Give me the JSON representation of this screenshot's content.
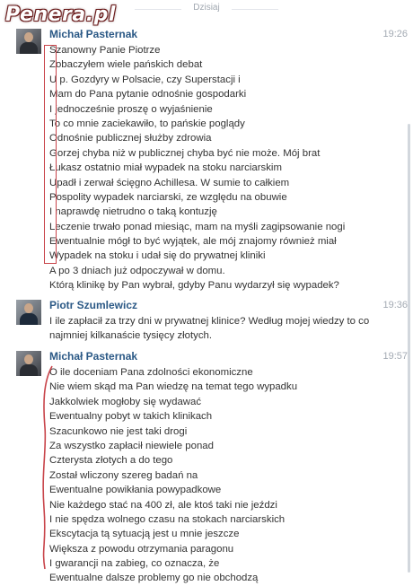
{
  "watermark": "Penera.pl",
  "date_separator": "Dzisiaj",
  "messages": [
    {
      "sender": "Michał Pasternak",
      "time": "19:26",
      "lines": [
        "Szanowny Panie Piotrze",
        "Zobaczyłem wiele pańskich debat",
        "U p. Gozdyry w Polsacie, czy Superstacji i",
        "Mam do Pana pytanie odnośnie gospodarki",
        "I jednocześnie proszę o wyjaśnienie",
        "To co mnie zaciekawiło, to pańskie poglądy",
        "Odnośnie publicznej służby zdrowia",
        "Gorzej chyba niż w publicznej chyba być nie może. Mój brat",
        "Łukasz ostatnio miał wypadek na stoku narciarskim",
        "Upadł i zerwał ścięgno Achillesa. W sumie to całkiem",
        "Pospolity wypadek narciarski, ze względu na obuwie",
        "I naprawdę nietrudno o taką kontuzję",
        "Leczenie trwało ponad miesiąc, mam na myśli zagipsowanie nogi",
        "Ewentualnie mógł to być wyjątek, ale mój znajomy również miał",
        "Wypadek na stoku i udał się do prywatnej kliniki",
        "A po 3 dniach już odpoczywał w domu.",
        "Którą klinikę by Pan wybrał, gdyby Panu wydarzył się wypadek?"
      ]
    },
    {
      "sender": "Piotr Szumlewicz",
      "time": "19:36",
      "text": "I ile zapłacił za trzy dni w prywatnej klinice? Według mojej wiedzy to co najmniej kilkanaście tysięcy złotych."
    },
    {
      "sender": "Michał Pasternak",
      "time": "19:57",
      "lines": [
        "O ile doceniam Pana zdolności ekonomiczne",
        "Nie wiem skąd ma Pan wiedzę na temat tego wypadku",
        "Jakkolwiek mogłoby się wydawać",
        "Ewentualny pobyt w takich klinikach",
        "Szacunkowo nie jest taki drogi",
        "Za wszystko zapłacił niewiele ponad",
        "Czterysta złotych a do tego",
        "Został wliczony szereg badań na",
        "Ewentualne powikłania powypadkowe",
        "Nie każdego stać na 400 zł, ale ktoś taki nie jeździ",
        "I nie spędza wolnego czasu na stokach narciarskich",
        "Ekscytacja tą sytuacją jest u mnie jeszcze",
        "Większa z powodu otrzymania paragonu",
        "I gwarancji na zabieg, co oznacza, że",
        "Ewentualne dalsze problemy go nie obchodzą"
      ]
    }
  ]
}
